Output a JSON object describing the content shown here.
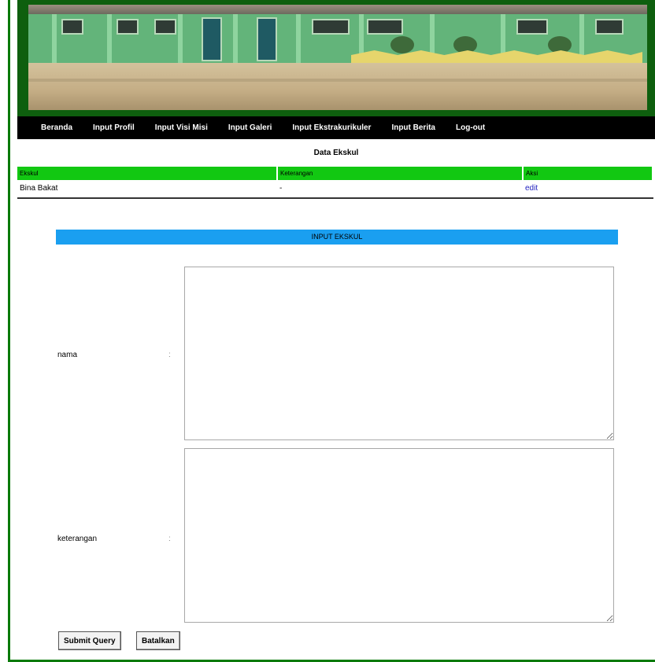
{
  "nav": {
    "items": [
      "Beranda",
      "Input Profil",
      "Input Visi Misi",
      "Input Galeri",
      "Input Ekstrakurikuler",
      "Input Berita",
      "Log-out"
    ]
  },
  "data_section": {
    "title": "Data Ekskul",
    "columns": [
      "Ekskul",
      "Keterangan",
      "Aksi"
    ],
    "rows": [
      {
        "nama": "Bina Bakat",
        "keterangan": "-",
        "aksi": "edit"
      }
    ]
  },
  "form": {
    "header": "INPUT EKSKUL",
    "nama_label": "nama",
    "keterangan_label": "keterangan",
    "colon": ":",
    "nama_value": "",
    "keterangan_value": "",
    "submit_label": "Submit Query",
    "reset_label": "Batalkan"
  },
  "colors": {
    "nav_bg": "#000000",
    "table_header": "#12c812",
    "form_header": "#1a9ff0",
    "frame_border": "#0a7a0a"
  }
}
